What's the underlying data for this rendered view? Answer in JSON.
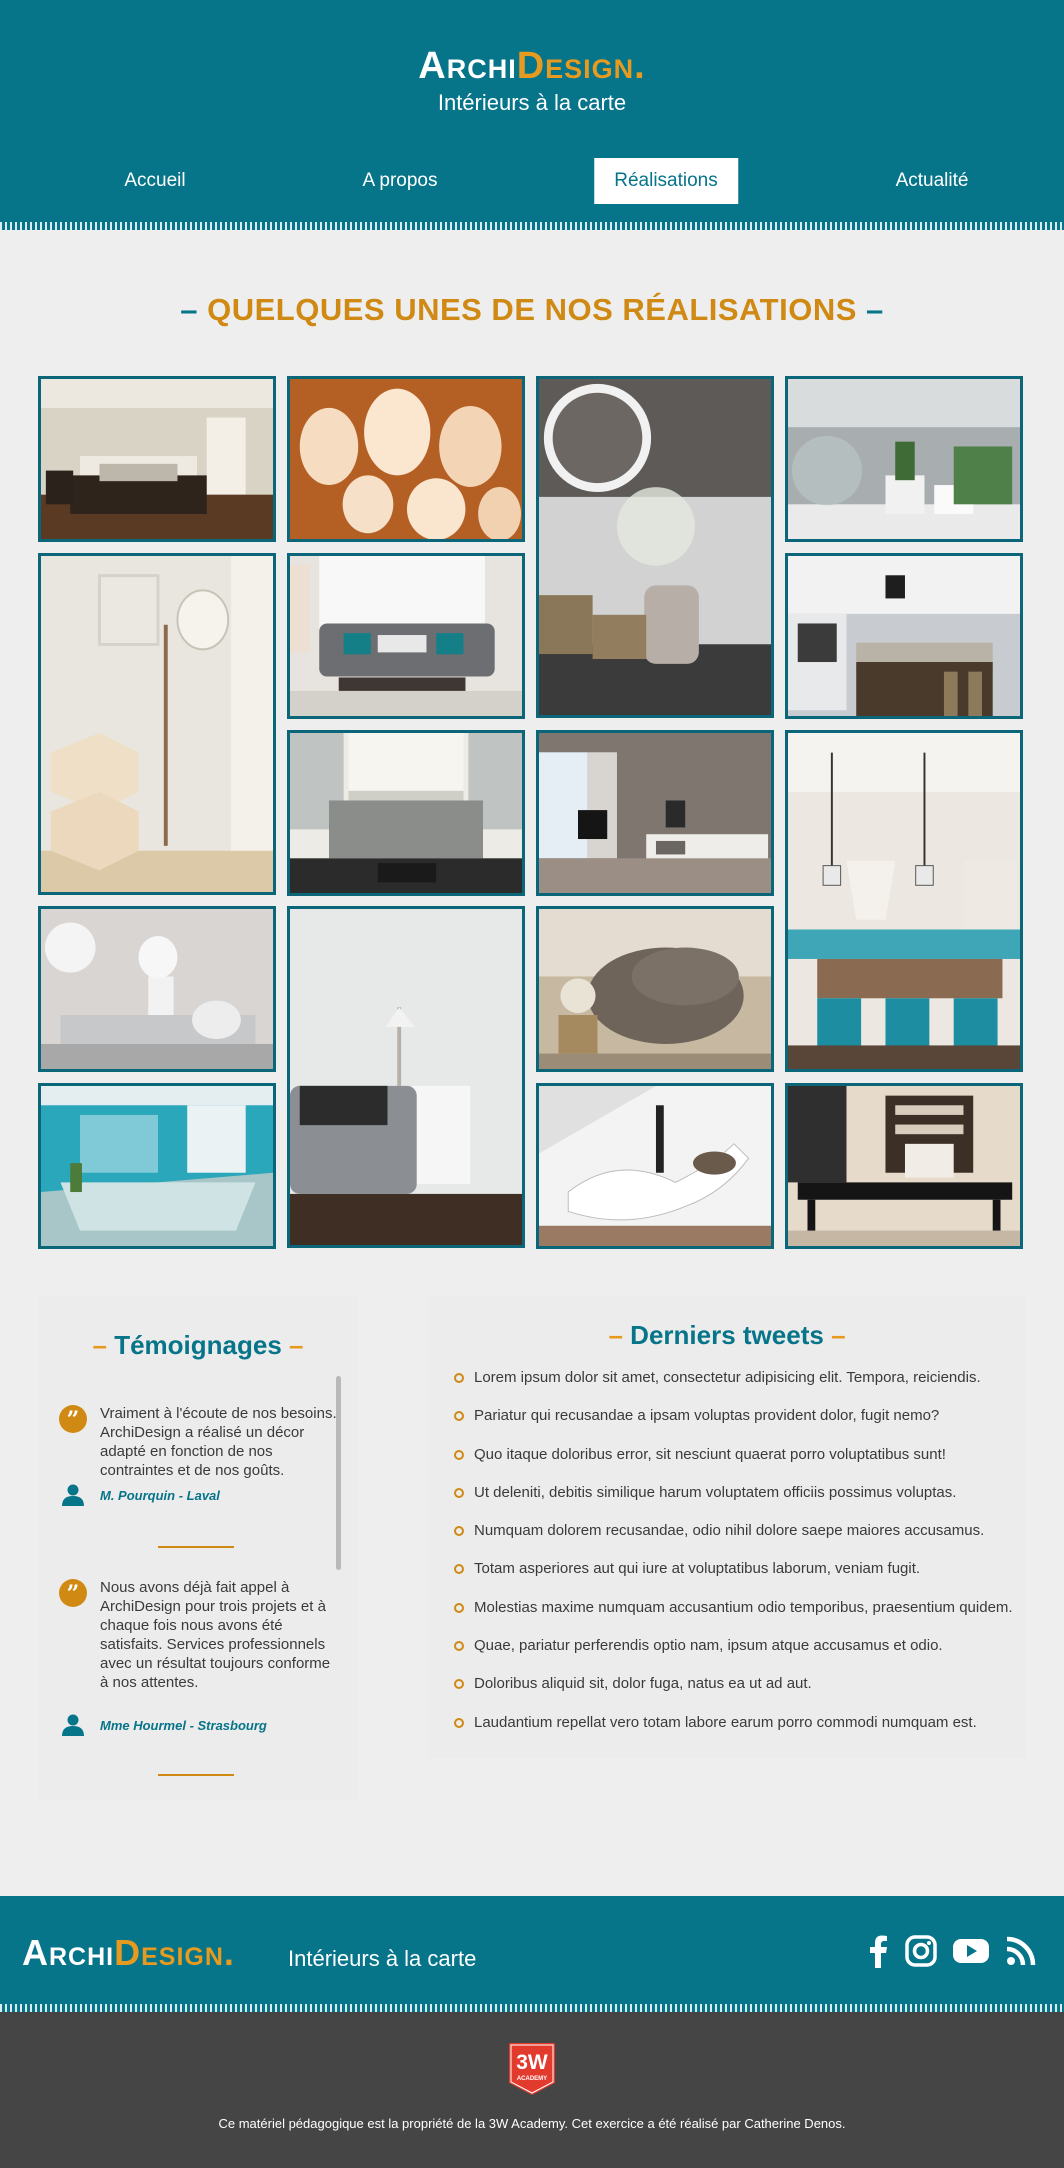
{
  "header": {
    "brand_a": "Archi",
    "brand_d": "Design.",
    "tagline": "Intérieurs à la carte",
    "nav": [
      "Accueil",
      "A propos",
      "Réalisations",
      "Actualité"
    ]
  },
  "gallery": {
    "title": "Quelques unes de nos réalisations",
    "dash": "–"
  },
  "testimonials": {
    "title": "Témoignages",
    "dash": "–",
    "items": [
      {
        "text": "Vraiment à l'écoute de nos besoins. ArchiDesign a réalisé un décor adapté en fonction de nos contraintes et de nos goûts.",
        "author": "M. Pourquin - Laval"
      },
      {
        "text": "Nous avons déjà fait appel à ArchiDesign pour trois projets et à chaque fois nous avons été satisfaits. Services professionnels avec un résultat toujours conforme à nos attentes.",
        "author": "Mme Hourmel - Strasbourg"
      }
    ]
  },
  "tweets": {
    "title": "Derniers tweets",
    "dash": "–",
    "items": [
      "Lorem ipsum dolor sit amet, consectetur adipisicing elit. Tempora, reiciendis.",
      "Pariatur qui recusandae a ipsam voluptas provident dolor, fugit nemo?",
      "Quo itaque doloribus error, sit nesciunt quaerat porro voluptatibus sunt!",
      "Ut deleniti, debitis similique harum voluptatem officiis possimus voluptas.",
      "Numquam dolorem recusandae, odio nihil dolore saepe maiores accusamus.",
      "Totam asperiores aut qui iure at voluptatibus laborum, veniam fugit.",
      "Molestias maxime numquam accusantium odio temporibus, praesentium quidem.",
      "Quae, pariatur perferendis optio nam, ipsum atque accusamus et odio.",
      "Doloribus aliquid sit, dolor fuga, natus ea ut ad aut.",
      "Laudantium repellat vero totam labore earum porro commodi numquam est."
    ]
  },
  "footer": {
    "brand_a": "Archi",
    "brand_d": "Design.",
    "tagline": "Intérieurs à la carte",
    "social": [
      "facebook-icon",
      "instagram-icon",
      "youtube-icon",
      "rss-icon"
    ],
    "logo_text": "3W",
    "logo_sub": "ACADEMY",
    "copyright": "Ce matériel pédagogique est la propriété de la 3W Academy. Cet exercice a été réalisé par Catherine Denos."
  },
  "colors": {
    "primary": "#067489",
    "accent": "#e69a1f",
    "dark": "#454545"
  }
}
